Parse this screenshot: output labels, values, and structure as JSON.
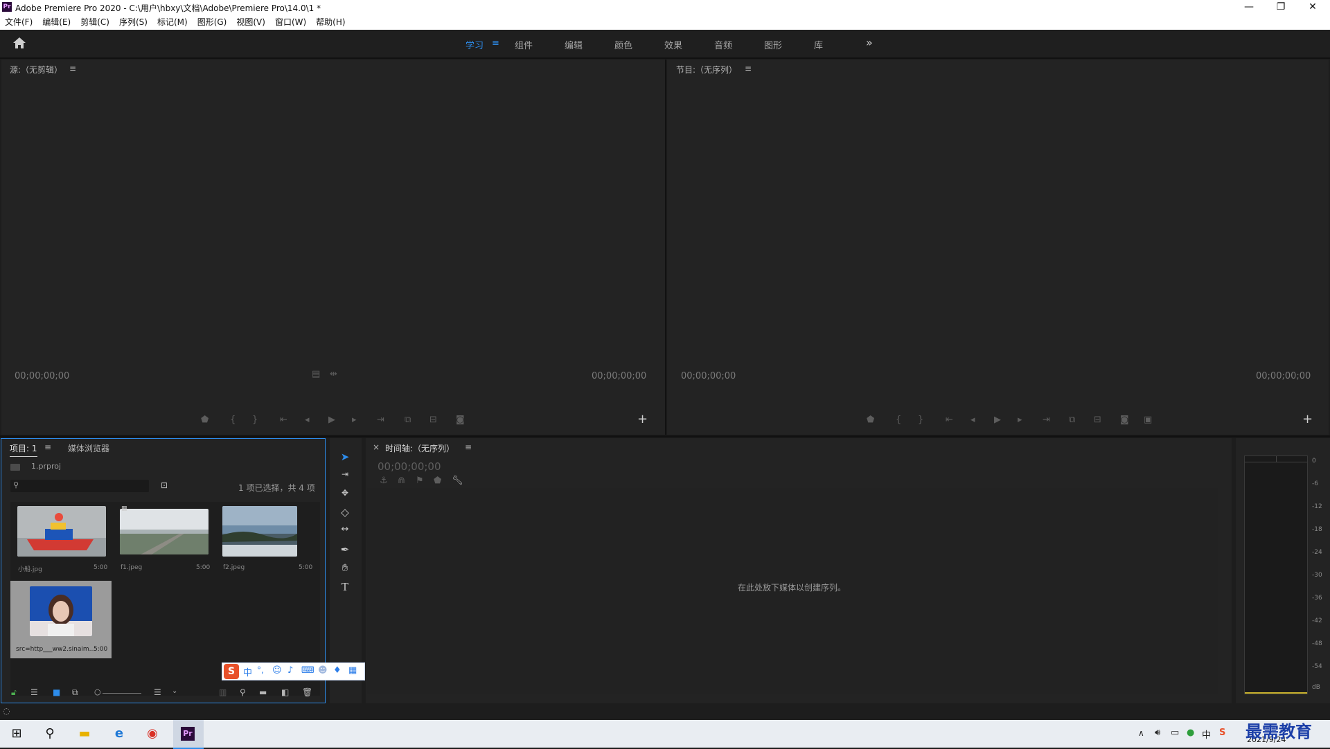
{
  "window": {
    "title": "Adobe Premiere Pro 2020 - C:\\用户\\hbxy\\文档\\Adobe\\Premiere Pro\\14.0\\1 *",
    "logo": "Pr",
    "minimize": "—",
    "restore": "❐",
    "close": "✕"
  },
  "menu": [
    "文件(F)",
    "编辑(E)",
    "剪辑(C)",
    "序列(S)",
    "标记(M)",
    "图形(G)",
    "视图(V)",
    "窗口(W)",
    "帮助(H)"
  ],
  "workspaces": {
    "tabs": [
      "学习",
      "组件",
      "编辑",
      "颜色",
      "效果",
      "音频",
      "图形",
      "库"
    ],
    "active_menu": "≡",
    "overflow": "»"
  },
  "source_monitor": {
    "title": "源:（无剪辑）",
    "menu": "≡",
    "tc_left": "00;00;00;00",
    "tc_right": "00;00;00;00",
    "add": "+"
  },
  "program_monitor": {
    "title": "节目:（无序列）",
    "menu": "≡",
    "tc_left": "00;00;00;00",
    "tc_right": "00;00;00;00",
    "add": "+"
  },
  "project": {
    "tab_project": "项目: 1",
    "tab_menu": "≡",
    "tab_media": "媒体浏览器",
    "filename": "1.prproj",
    "selection_status": "1 项已选择，共 4 项",
    "items": [
      {
        "name": "小船.jpg",
        "duration": "5:00"
      },
      {
        "name": "f1.jpeg",
        "duration": "5:00"
      },
      {
        "name": "f2.jpeg",
        "duration": "5:00"
      },
      {
        "name": "src=http___ww2.sinaim...",
        "duration": "5:00"
      }
    ]
  },
  "timeline": {
    "close": "×",
    "title": "时间轴:（无序列）",
    "menu": "≡",
    "timecode": "00;00;00;00",
    "empty_hint": "在此处放下媒体以创建序列。"
  },
  "audio_meter": {
    "labels": [
      "0",
      "-6",
      "-12",
      "-18",
      "-24",
      "-30",
      "-36",
      "-42",
      "-48",
      "-54",
      "dB"
    ]
  },
  "ime": {
    "label": "中"
  },
  "taskbar": {
    "date": "2021/9/24",
    "watermark": "最需教育"
  },
  "colors": {
    "accent": "#2d8ceb",
    "panel": "#232323",
    "background": "#1d1d1d"
  }
}
